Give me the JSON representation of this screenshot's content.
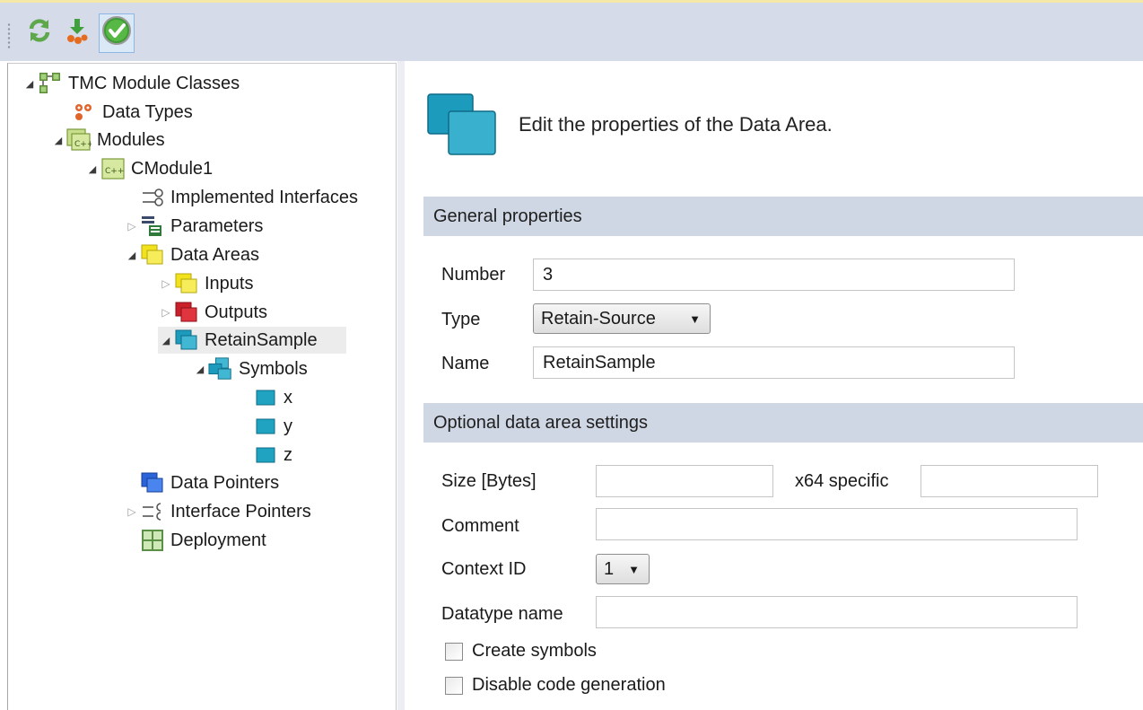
{
  "toolbar": {
    "buttons": [
      {
        "icon": "refresh-icon"
      },
      {
        "icon": "download-icon"
      },
      {
        "icon": "check-icon",
        "active": true
      }
    ]
  },
  "tree": {
    "items": [
      {
        "label": "TMC Module Classes",
        "icon": "module-classes-icon",
        "expander": "expanded"
      },
      {
        "label": "Data Types",
        "icon": "data-types-icon",
        "expander": "none"
      },
      {
        "label": "Modules",
        "icon": "modules-icon",
        "expander": "expanded"
      },
      {
        "label": "CModule1",
        "icon": "cmodule-icon",
        "expander": "expanded"
      },
      {
        "label": "Implemented Interfaces",
        "icon": "interfaces-icon",
        "expander": "none"
      },
      {
        "label": "Parameters",
        "icon": "parameters-icon",
        "expander": "collapsed"
      },
      {
        "label": "Data Areas",
        "icon": "data-areas-icon",
        "expander": "expanded"
      },
      {
        "label": "Inputs",
        "icon": "inputs-icon",
        "expander": "collapsed"
      },
      {
        "label": "Outputs",
        "icon": "outputs-icon",
        "expander": "collapsed"
      },
      {
        "label": "RetainSample",
        "icon": "retain-icon",
        "expander": "expanded",
        "selected": true
      },
      {
        "label": "Symbols",
        "icon": "symbols-icon",
        "expander": "expanded"
      },
      {
        "label": "x",
        "icon": "symbol-icon",
        "expander": "none"
      },
      {
        "label": "y",
        "icon": "symbol-icon",
        "expander": "none"
      },
      {
        "label": "z",
        "icon": "symbol-icon",
        "expander": "none"
      },
      {
        "label": "Data Pointers",
        "icon": "data-pointers-icon",
        "expander": "none"
      },
      {
        "label": "Interface Pointers",
        "icon": "interface-pointers-icon",
        "expander": "collapsed"
      },
      {
        "label": "Deployment",
        "icon": "deployment-icon",
        "expander": "none"
      }
    ]
  },
  "editor": {
    "header_text": "Edit the properties of the Data Area.",
    "general_section": "General properties",
    "number_label": "Number",
    "number_value": "3",
    "type_label": "Type",
    "type_value": "Retain-Source",
    "name_label": "Name",
    "name_value": "RetainSample",
    "optional_section": "Optional data area settings",
    "size_label": "Size [Bytes]",
    "size_value": "",
    "x64_label": "x64 specific",
    "x64_value": "",
    "comment_label": "Comment",
    "comment_value": "",
    "context_label": "Context ID",
    "context_value": "1",
    "datatype_label": "Datatype name",
    "datatype_value": "",
    "create_symbols_label": "Create symbols",
    "create_symbols_checked": false,
    "disable_codegen_label": "Disable code generation",
    "disable_codegen_checked": false
  },
  "colors": {
    "toolbar_bg": "#d6dbe9",
    "section_bg": "#cfd6e4",
    "teal": "#1fa3c0",
    "yellow": "#f2e21b",
    "red": "#c9202a",
    "blue": "#2b63d8"
  }
}
